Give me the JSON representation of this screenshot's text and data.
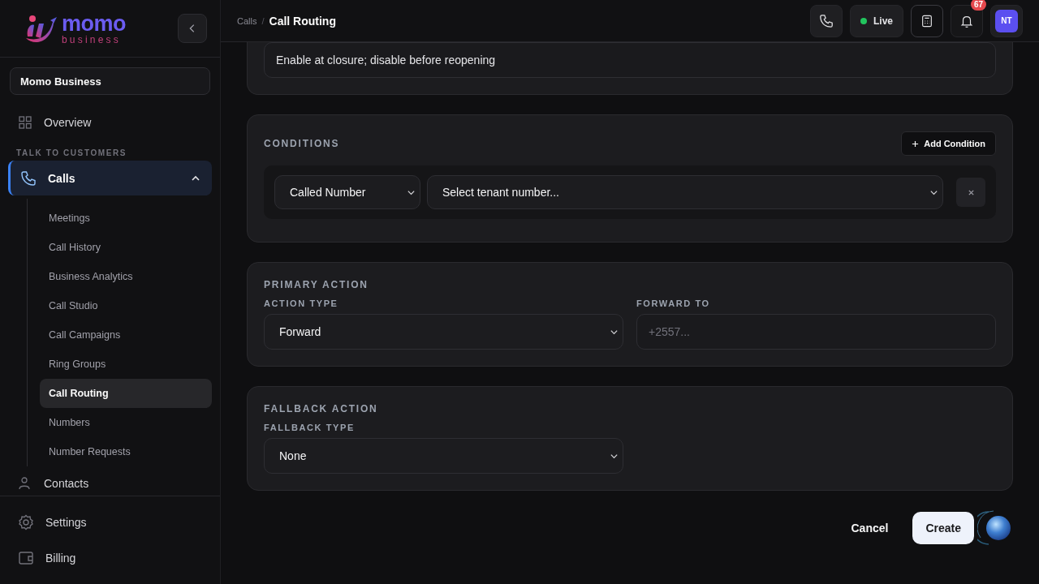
{
  "logo": {
    "name": "momo",
    "tagline": "business"
  },
  "workspace": {
    "value": "Momo Business"
  },
  "sidebar": {
    "items": [
      {
        "kind": "link",
        "label": "Overview",
        "selected": false
      },
      {
        "kind": "heading",
        "label": "TALK TO CUSTOMERS"
      },
      {
        "kind": "group",
        "label": "Calls",
        "selected": true,
        "expanded": true,
        "children": [
          {
            "label": "Meetings",
            "selected": false
          },
          {
            "label": "Call History",
            "selected": false
          },
          {
            "label": "Business Analytics",
            "selected": false
          },
          {
            "label": "Call Studio",
            "selected": false
          },
          {
            "label": "Call Campaigns",
            "selected": false
          },
          {
            "label": "Ring Groups",
            "selected": false
          },
          {
            "label": "Call Routing",
            "selected": true
          },
          {
            "label": "Numbers",
            "selected": false
          },
          {
            "label": "Number Requests",
            "selected": false
          }
        ]
      },
      {
        "kind": "link",
        "label": "Contacts",
        "selected": false
      }
    ],
    "footer_items": [
      {
        "label": "Settings"
      },
      {
        "label": "Billing"
      }
    ]
  },
  "header": {
    "breadcrumb": [
      "Calls"
    ],
    "breadcrumb_separator": "/",
    "title": "Call Routing",
    "status": {
      "label": "Live",
      "on": true
    },
    "notifications": "67",
    "avatar": "NT"
  },
  "schedule_note": {
    "value": "Enable at closure; disable before reopening"
  },
  "conditions": {
    "title": "CONDITIONS",
    "add_button": "Add Condition",
    "rows": [
      {
        "field": "Called Number",
        "value": "Select tenant number..."
      }
    ]
  },
  "primary_action": {
    "title": "PRIMARY ACTION",
    "fields": [
      {
        "kind": "select",
        "label": "ACTION TYPE",
        "value": "Forward"
      },
      {
        "kind": "input",
        "label": "FORWARD TO",
        "placeholder": "+2557..."
      }
    ]
  },
  "fallback_action": {
    "title": "FALLBACK ACTION",
    "fields": [
      {
        "kind": "select",
        "label": "FALLBACK TYPE",
        "value": "None"
      }
    ]
  },
  "buttons": {
    "cancel": "Cancel",
    "create": "Create"
  }
}
